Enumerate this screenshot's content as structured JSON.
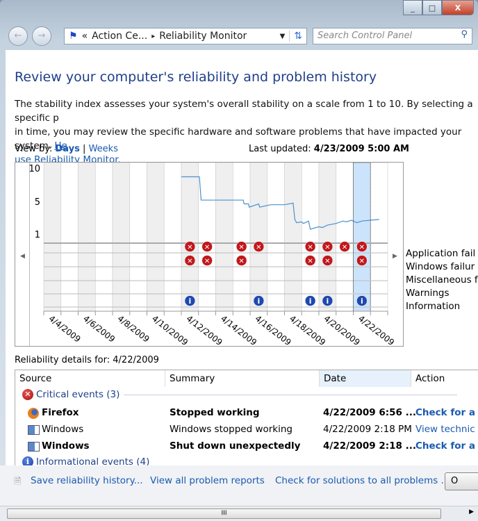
{
  "window": {
    "close": "X",
    "minimize": "_",
    "maximize": "□"
  },
  "address": {
    "prefix": "«",
    "crumb1": "Action Ce...",
    "separator": "▸",
    "crumb2": "Reliability Monitor"
  },
  "search": {
    "placeholder": "Search Control Panel"
  },
  "page": {
    "title": "Review your computer's reliability and problem history",
    "desc1": "The stability index assesses your system's overall stability on a scale from 1 to 10. By selecting a specific p",
    "desc2": "in time, you may review the specific hardware and software problems that have impacted your system.",
    "desc2_link": "He",
    "desc3_link": "use Reliability Monitor.",
    "view_by_label": "View by:",
    "view_days": "Days",
    "view_sep": "|",
    "view_weeks": "Weeks",
    "last_updated_label": "Last updated:",
    "last_updated_value": "4/23/2009 5:00 AM"
  },
  "chart_data": {
    "type": "line",
    "ylim": [
      1,
      10
    ],
    "y_ticks": [
      "10",
      "5",
      "1"
    ],
    "categories": [
      "4/4/2009",
      "4/5/2009",
      "4/6/2009",
      "4/7/2009",
      "4/8/2009",
      "4/9/2009",
      "4/10/2009",
      "4/11/2009",
      "4/12/2009",
      "4/13/2009",
      "4/14/2009",
      "4/15/2009",
      "4/16/2009",
      "4/17/2009",
      "4/18/2009",
      "4/19/2009",
      "4/20/2009",
      "4/21/2009",
      "4/22/2009",
      "4/23/2009"
    ],
    "x_tick_labels": [
      "4/4/2009",
      "4/6/2009",
      "4/8/2009",
      "4/10/2009",
      "4/12/2009",
      "4/14/2009",
      "4/16/2009",
      "4/18/2009",
      "4/20/2009",
      "4/22/2009"
    ],
    "selected": "4/22/2009",
    "stability_index": [
      [
        12.0,
        8.7
      ],
      [
        13.05,
        8.7
      ],
      [
        13.15,
        5.2
      ],
      [
        15.6,
        5.2
      ],
      [
        15.65,
        4.7
      ],
      [
        15.9,
        4.7
      ],
      [
        15.95,
        4.3
      ],
      [
        16.5,
        4.7
      ],
      [
        16.55,
        4.3
      ],
      [
        17.2,
        4.6
      ],
      [
        18.0,
        4.6
      ],
      [
        18.5,
        4.8
      ],
      [
        18.6,
        2.8
      ],
      [
        18.7,
        2.4
      ],
      [
        19.0,
        2.5
      ],
      [
        19.1,
        2.3
      ],
      [
        19.4,
        2.6
      ],
      [
        19.5,
        1.6
      ],
      [
        20.0,
        1.9
      ],
      [
        20.2,
        1.8
      ],
      [
        20.5,
        2.1
      ],
      [
        21.0,
        2.3
      ],
      [
        21.4,
        2.6
      ],
      [
        21.6,
        2.5
      ],
      [
        21.9,
        2.7
      ],
      [
        22.2,
        2.4
      ],
      [
        22.5,
        2.6
      ],
      [
        23.0,
        2.7
      ],
      [
        23.5,
        2.8
      ]
    ],
    "rows": [
      "Application failures",
      "Windows failures",
      "Miscellaneous failures",
      "Warnings",
      "Information"
    ],
    "row_labels_visible": [
      "Application fail",
      "Windows failur",
      "Miscellaneous f",
      "Warnings",
      "Information"
    ],
    "events": {
      "Application failures": [
        "4/12/2009",
        "4/13/2009",
        "4/15/2009",
        "4/16/2009",
        "4/19/2009",
        "4/20/2009",
        "4/21/2009",
        "4/22/2009"
      ],
      "Windows failures": [
        "4/12/2009",
        "4/13/2009",
        "4/15/2009",
        "4/19/2009",
        "4/20/2009",
        "4/22/2009"
      ],
      "Miscellaneous failures": [],
      "Warnings": [],
      "Information": [
        "4/12/2009",
        "4/16/2009",
        "4/19/2009",
        "4/20/2009",
        "4/22/2009"
      ]
    },
    "colors": {
      "line": "#4a90d0",
      "selected": "#cce4fb",
      "shade": "#efefef",
      "error": "#c0181c",
      "info": "#1f48b0"
    }
  },
  "details": {
    "label": "Reliability details for:",
    "date": "4/22/2009",
    "columns": [
      "Source",
      "Summary",
      "Date",
      "Action"
    ],
    "critical_group": "Critical events (3)",
    "info_group": "Informational events (4)",
    "rows": [
      {
        "source": "Firefox",
        "summary": "Stopped working",
        "date": "4/22/2009 6:56 ...",
        "action": "Check for a s",
        "bold": true,
        "icon": "firefox-icon"
      },
      {
        "source": "Windows",
        "summary": "Windows stopped working",
        "date": "4/22/2009 2:18 PM",
        "action": "View  technic",
        "bold": false,
        "icon": "window-app-icon"
      },
      {
        "source": "Windows",
        "summary": "Shut down unexpectedly",
        "date": "4/22/2009 2:18 ...",
        "action": "Check for a s",
        "bold": true,
        "icon": "window-app-icon"
      }
    ]
  },
  "footer": {
    "save": "Save reliability history...",
    "view_all": "View all problem reports",
    "check_all": "Check for solutions to all problems ...",
    "ok": "O"
  },
  "scrollbar": {
    "grip": "III"
  }
}
